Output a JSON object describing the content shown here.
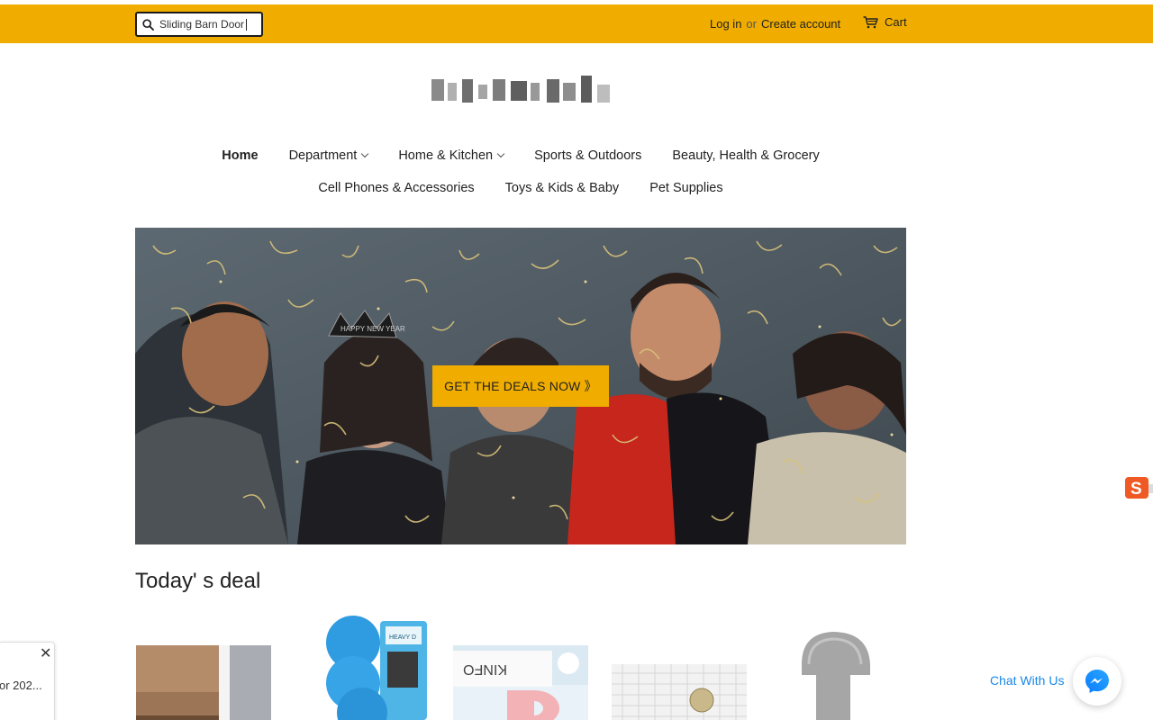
{
  "header": {
    "search": {
      "value": "Sliding Barn Door",
      "placeholder": "Search"
    },
    "login": "Log in",
    "or": "or",
    "create_account": "Create account",
    "cart": "Cart"
  },
  "nav": {
    "row1": [
      {
        "label": "Home",
        "active": true,
        "dropdown": false
      },
      {
        "label": "Department",
        "active": false,
        "dropdown": true
      },
      {
        "label": "Home & Kitchen",
        "active": false,
        "dropdown": true
      },
      {
        "label": "Sports & Outdoors",
        "active": false,
        "dropdown": false
      },
      {
        "label": "Beauty, Health & Grocery",
        "active": false,
        "dropdown": false
      }
    ],
    "row2": [
      {
        "label": "Cell Phones & Accessories"
      },
      {
        "label": "Toys & Kids & Baby"
      },
      {
        "label": "Pet Supplies"
      }
    ]
  },
  "hero": {
    "cta": "GET THE DEALS NOW 》",
    "banner_text": "HAPPY NEW YEAR"
  },
  "deals": {
    "title": "Today' s deal"
  },
  "popup": {
    "text": "or 202..."
  },
  "chat": {
    "label": "Chat With Us"
  },
  "product_cards": [
    {
      "icon": "wood-door-stop-image"
    },
    {
      "icon": "blue-pads-image",
      "label": "HEAVY D"
    },
    {
      "icon": "pink-tape-image",
      "label": "KINFO"
    },
    {
      "icon": "coin-grid-image"
    },
    {
      "icon": "gray-hook-image"
    }
  ],
  "colors": {
    "accent": "#f0ad00",
    "chat_blue": "#1a88e8",
    "text": "#222222"
  }
}
